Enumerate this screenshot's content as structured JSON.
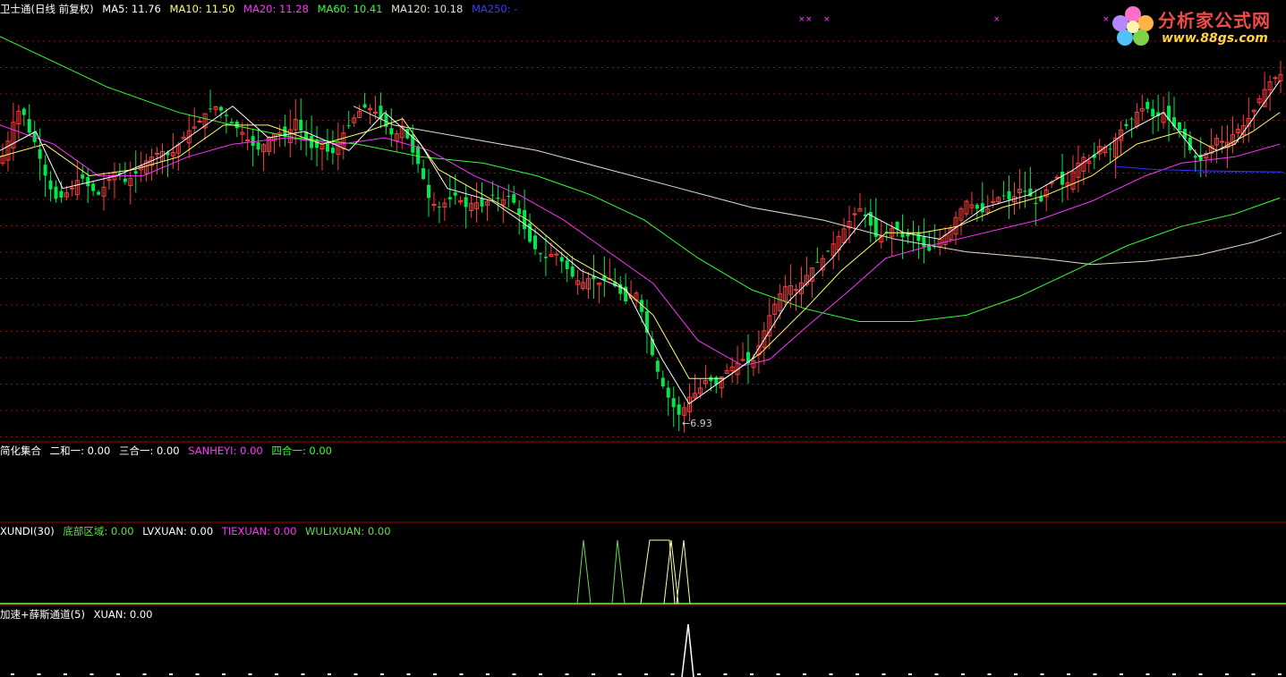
{
  "main_legend": {
    "title": "卫士通(日线 前复权)",
    "ma5": "MA5: 11.76",
    "ma10": "MA10: 11.50",
    "ma20": "MA20: 11.28",
    "ma60": "MA60: 10.41",
    "ma120": "MA120: 10.18",
    "ma250": "MA250: -"
  },
  "panel2_legend": {
    "title": "简化集合",
    "a": "二和一: 0.00",
    "b": "三合一: 0.00",
    "c": "SANHEYI: 0.00",
    "d": "四合一: 0.00"
  },
  "panel3_legend": {
    "title": "XUNDI(30)",
    "a": "底部区域: 0.00",
    "b": "LVXUAN: 0.00",
    "c": "TIEXUAN: 0.00",
    "d": "WULIXUAN: 0.00"
  },
  "panel4_legend": {
    "title": "加速+薛斯通道(5)",
    "a": "XUAN: 0.00"
  },
  "low_annotation": "←6.93",
  "logo": {
    "text": "分析家公式网",
    "url": "www.88gs.com"
  },
  "colors": {
    "up": "#ff3b3b",
    "down": "#00e84a",
    "ma5": "#ffffff",
    "ma10": "#ffff66",
    "ma20": "#ff33ff",
    "ma60": "#33ff33",
    "ma120": "#e0e0c8",
    "ma250": "#3030ff",
    "divider": "#aa0000",
    "grid": "#8a1010"
  },
  "chart_data": {
    "type": "candlestick",
    "price_range": [
      6.6,
      13.35
    ],
    "low_marker": 6.93,
    "close_path": [
      [
        0,
        11.0
      ],
      [
        8,
        11.3
      ],
      [
        16,
        11.7
      ],
      [
        24,
        11.9
      ],
      [
        32,
        11.5
      ],
      [
        40,
        11.3
      ],
      [
        48,
        10.9
      ],
      [
        56,
        10.6
      ],
      [
        64,
        10.4
      ],
      [
        72,
        10.5
      ],
      [
        80,
        10.6
      ],
      [
        90,
        10.8
      ],
      [
        100,
        10.6
      ],
      [
        110,
        10.5
      ],
      [
        120,
        10.7
      ],
      [
        130,
        10.9
      ],
      [
        140,
        10.7
      ],
      [
        150,
        10.8
      ],
      [
        160,
        11.0
      ],
      [
        170,
        11.1
      ],
      [
        180,
        11.2
      ],
      [
        190,
        11.1
      ],
      [
        200,
        11.3
      ],
      [
        210,
        11.5
      ],
      [
        220,
        11.6
      ],
      [
        230,
        11.8
      ],
      [
        240,
        11.9
      ],
      [
        250,
        11.8
      ],
      [
        260,
        11.6
      ],
      [
        270,
        11.5
      ],
      [
        280,
        11.3
      ],
      [
        290,
        11.2
      ],
      [
        300,
        11.4
      ],
      [
        310,
        11.5
      ],
      [
        320,
        11.4
      ],
      [
        330,
        11.7
      ],
      [
        340,
        11.4
      ],
      [
        350,
        11.2
      ],
      [
        360,
        11.3
      ],
      [
        370,
        11.1
      ],
      [
        380,
        11.4
      ],
      [
        390,
        11.6
      ],
      [
        400,
        11.8
      ],
      [
        410,
        11.9
      ],
      [
        420,
        11.8
      ],
      [
        430,
        11.6
      ],
      [
        440,
        11.4
      ],
      [
        450,
        11.6
      ],
      [
        460,
        11.2
      ],
      [
        470,
        10.9
      ],
      [
        480,
        10.4
      ],
      [
        490,
        10.3
      ],
      [
        500,
        10.4
      ],
      [
        510,
        10.5
      ],
      [
        520,
        10.3
      ],
      [
        530,
        10.4
      ],
      [
        540,
        10.3
      ],
      [
        550,
        10.5
      ],
      [
        560,
        10.4
      ],
      [
        570,
        10.5
      ],
      [
        580,
        10.2
      ],
      [
        590,
        9.8
      ],
      [
        600,
        9.6
      ],
      [
        610,
        9.5
      ],
      [
        620,
        9.6
      ],
      [
        630,
        9.4
      ],
      [
        640,
        9.2
      ],
      [
        650,
        9.1
      ],
      [
        660,
        9.2
      ],
      [
        670,
        9.1
      ],
      [
        680,
        9.2
      ],
      [
        690,
        9.0
      ],
      [
        700,
        8.8
      ],
      [
        710,
        9.0
      ],
      [
        720,
        8.5
      ],
      [
        730,
        7.9
      ],
      [
        740,
        7.5
      ],
      [
        750,
        7.2
      ],
      [
        760,
        7.0
      ],
      [
        770,
        7.3
      ],
      [
        780,
        7.4
      ],
      [
        790,
        7.6
      ],
      [
        800,
        7.5
      ],
      [
        810,
        7.7
      ],
      [
        820,
        7.8
      ],
      [
        830,
        7.9
      ],
      [
        840,
        7.8
      ],
      [
        850,
        8.2
      ],
      [
        860,
        8.6
      ],
      [
        870,
        8.9
      ],
      [
        880,
        9.1
      ],
      [
        890,
        9.0
      ],
      [
        900,
        9.2
      ],
      [
        910,
        9.4
      ],
      [
        920,
        9.5
      ],
      [
        930,
        9.7
      ],
      [
        940,
        9.9
      ],
      [
        950,
        10.1
      ],
      [
        960,
        10.3
      ],
      [
        970,
        10.1
      ],
      [
        980,
        9.8
      ],
      [
        990,
        9.9
      ],
      [
        1000,
        10.0
      ],
      [
        1010,
        9.8
      ],
      [
        1020,
        9.9
      ],
      [
        1030,
        9.7
      ],
      [
        1040,
        9.6
      ],
      [
        1050,
        9.8
      ],
      [
        1060,
        9.9
      ],
      [
        1070,
        10.2
      ],
      [
        1080,
        10.4
      ],
      [
        1090,
        10.3
      ],
      [
        1100,
        10.2
      ],
      [
        1110,
        10.4
      ],
      [
        1120,
        10.5
      ],
      [
        1130,
        10.4
      ],
      [
        1140,
        10.6
      ],
      [
        1150,
        10.5
      ],
      [
        1160,
        10.3
      ],
      [
        1170,
        10.6
      ],
      [
        1180,
        10.8
      ],
      [
        1190,
        10.6
      ],
      [
        1200,
        10.9
      ],
      [
        1210,
        11.1
      ],
      [
        1220,
        11.0
      ],
      [
        1230,
        11.3
      ],
      [
        1240,
        11.2
      ],
      [
        1250,
        11.5
      ],
      [
        1260,
        11.6
      ],
      [
        1270,
        11.8
      ],
      [
        1280,
        11.9
      ],
      [
        1290,
        11.7
      ],
      [
        1300,
        11.8
      ],
      [
        1310,
        11.6
      ],
      [
        1320,
        11.5
      ],
      [
        1330,
        11.2
      ],
      [
        1340,
        11.0
      ],
      [
        1350,
        11.2
      ],
      [
        1360,
        11.4
      ],
      [
        1370,
        11.3
      ],
      [
        1380,
        11.5
      ],
      [
        1390,
        11.6
      ],
      [
        1400,
        11.8
      ],
      [
        1410,
        12.1
      ],
      [
        1420,
        12.3
      ],
      [
        1430,
        12.4
      ]
    ],
    "ma5": [
      [
        0,
        11.2
      ],
      [
        40,
        11.5
      ],
      [
        70,
        10.6
      ],
      [
        130,
        10.8
      ],
      [
        180,
        11.1
      ],
      [
        230,
        11.6
      ],
      [
        260,
        11.9
      ],
      [
        300,
        11.4
      ],
      [
        340,
        11.5
      ],
      [
        390,
        11.2
      ],
      [
        430,
        11.8
      ],
      [
        470,
        11.3
      ],
      [
        500,
        10.6
      ],
      [
        550,
        10.4
      ],
      [
        600,
        9.9
      ],
      [
        650,
        9.3
      ],
      [
        700,
        9.0
      ],
      [
        740,
        7.9
      ],
      [
        770,
        7.2
      ],
      [
        800,
        7.5
      ],
      [
        840,
        7.9
      ],
      [
        880,
        8.8
      ],
      [
        930,
        9.5
      ],
      [
        970,
        10.2
      ],
      [
        1010,
        9.9
      ],
      [
        1050,
        9.8
      ],
      [
        1100,
        10.3
      ],
      [
        1150,
        10.5
      ],
      [
        1200,
        10.9
      ],
      [
        1260,
        11.5
      ],
      [
        1300,
        11.8
      ],
      [
        1340,
        11.1
      ],
      [
        1380,
        11.3
      ],
      [
        1430,
        12.3
      ]
    ],
    "ma10": [
      [
        0,
        11.1
      ],
      [
        50,
        11.3
      ],
      [
        100,
        10.8
      ],
      [
        150,
        10.9
      ],
      [
        200,
        11.1
      ],
      [
        250,
        11.6
      ],
      [
        300,
        11.6
      ],
      [
        360,
        11.3
      ],
      [
        410,
        11.5
      ],
      [
        450,
        11.7
      ],
      [
        490,
        10.9
      ],
      [
        540,
        10.5
      ],
      [
        590,
        10.1
      ],
      [
        640,
        9.5
      ],
      [
        690,
        9.1
      ],
      [
        730,
        8.6
      ],
      [
        770,
        7.6
      ],
      [
        810,
        7.6
      ],
      [
        850,
        8.0
      ],
      [
        900,
        8.7
      ],
      [
        940,
        9.3
      ],
      [
        990,
        9.9
      ],
      [
        1030,
        9.9
      ],
      [
        1070,
        10.0
      ],
      [
        1120,
        10.3
      ],
      [
        1170,
        10.5
      ],
      [
        1220,
        10.8
      ],
      [
        1270,
        11.3
      ],
      [
        1320,
        11.5
      ],
      [
        1360,
        11.2
      ],
      [
        1400,
        11.5
      ],
      [
        1430,
        11.8
      ]
    ],
    "ma20": [
      [
        0,
        11.6
      ],
      [
        60,
        11.3
      ],
      [
        110,
        10.8
      ],
      [
        160,
        10.8
      ],
      [
        210,
        11.1
      ],
      [
        260,
        11.3
      ],
      [
        320,
        11.4
      ],
      [
        380,
        11.3
      ],
      [
        430,
        11.4
      ],
      [
        480,
        11.2
      ],
      [
        530,
        10.8
      ],
      [
        580,
        10.5
      ],
      [
        630,
        10.1
      ],
      [
        680,
        9.6
      ],
      [
        730,
        9.1
      ],
      [
        780,
        8.2
      ],
      [
        830,
        7.8
      ],
      [
        860,
        7.9
      ],
      [
        900,
        8.4
      ],
      [
        950,
        9.0
      ],
      [
        990,
        9.5
      ],
      [
        1040,
        9.7
      ],
      [
        1100,
        9.9
      ],
      [
        1160,
        10.1
      ],
      [
        1220,
        10.4
      ],
      [
        1280,
        10.8
      ],
      [
        1320,
        11.0
      ],
      [
        1380,
        11.1
      ],
      [
        1430,
        11.3
      ]
    ],
    "ma60": [
      [
        0,
        13.0
      ],
      [
        60,
        12.6
      ],
      [
        120,
        12.2
      ],
      [
        200,
        11.8
      ],
      [
        260,
        11.6
      ],
      [
        330,
        11.4
      ],
      [
        400,
        11.3
      ],
      [
        470,
        11.1
      ],
      [
        540,
        11.0
      ],
      [
        600,
        10.8
      ],
      [
        660,
        10.5
      ],
      [
        720,
        10.1
      ],
      [
        780,
        9.5
      ],
      [
        840,
        9.0
      ],
      [
        900,
        8.7
      ],
      [
        960,
        8.5
      ],
      [
        1020,
        8.5
      ],
      [
        1080,
        8.6
      ],
      [
        1140,
        8.9
      ],
      [
        1200,
        9.3
      ],
      [
        1260,
        9.7
      ],
      [
        1320,
        10.0
      ],
      [
        1380,
        10.2
      ],
      [
        1430,
        10.45
      ]
    ],
    "ma120": [
      [
        395,
        11.9
      ],
      [
        440,
        11.6
      ],
      [
        520,
        11.4
      ],
      [
        600,
        11.2
      ],
      [
        680,
        10.9
      ],
      [
        760,
        10.6
      ],
      [
        840,
        10.3
      ],
      [
        920,
        10.1
      ],
      [
        1000,
        9.8
      ],
      [
        1080,
        9.6
      ],
      [
        1160,
        9.5
      ],
      [
        1220,
        9.4
      ],
      [
        1280,
        9.45
      ],
      [
        1340,
        9.55
      ],
      [
        1400,
        9.75
      ],
      [
        1432,
        9.9
      ]
    ],
    "ma250": [
      [
        1245,
        10.95
      ],
      [
        1290,
        10.9
      ],
      [
        1340,
        10.88
      ],
      [
        1390,
        10.87
      ],
      [
        1432,
        10.86
      ]
    ],
    "marker_x": [
      892,
      900,
      920,
      1110,
      1232
    ],
    "xundi_peaks": [
      {
        "color": "#66dd44",
        "points": [
          [
            645,
            675
          ],
          [
            652,
            604
          ],
          [
            660,
            675
          ]
        ]
      },
      {
        "color": "#66dd44",
        "points": [
          [
            684,
            675
          ],
          [
            690,
            604
          ],
          [
            698,
            675
          ]
        ]
      },
      {
        "color": "#ffffaa",
        "points": [
          [
            716,
            675
          ],
          [
            726,
            604
          ],
          [
            748,
            604
          ],
          [
            754,
            675
          ]
        ]
      },
      {
        "color": "#ffffaa",
        "points": [
          [
            742,
            675
          ],
          [
            750,
            604
          ],
          [
            758,
            675
          ]
        ]
      },
      {
        "color": "#ffffaa",
        "points": [
          [
            756,
            675
          ],
          [
            764,
            604
          ],
          [
            771,
            675
          ]
        ]
      }
    ],
    "xuan_peak": [
      [
        762,
        757
      ],
      [
        769,
        698
      ],
      [
        775,
        757
      ]
    ]
  }
}
